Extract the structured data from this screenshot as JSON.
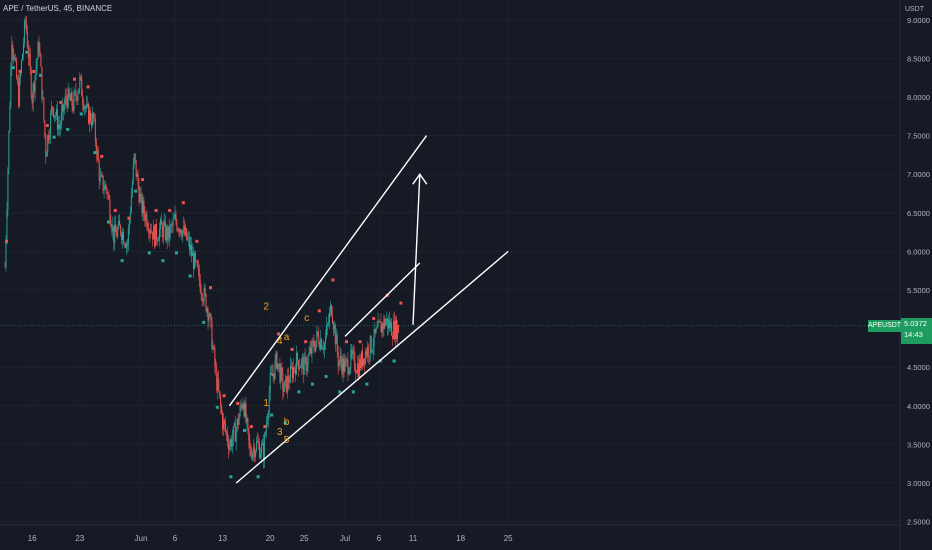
{
  "header": {
    "symbol_line": "APE / TetherUS, 45, BINANCE",
    "currency": "USDT"
  },
  "price_tag": {
    "ticker": "APEUSDT",
    "price": "5.0372",
    "countdown": "14:43"
  },
  "colors": {
    "background": "#161a25",
    "up": "#26a69a",
    "down": "#ef5350",
    "annotation": "#f7a21b",
    "line": "#ffffff"
  },
  "chart_data": {
    "type": "candlestick",
    "symbol": "APE/TetherUS",
    "interval": "45",
    "exchange": "BINANCE",
    "y_ticks": [
      "9.0000",
      "8.5000",
      "8.0000",
      "7.5000",
      "7.0000",
      "6.5000",
      "6.0000",
      "5.5000",
      "4.5000",
      "4.0000",
      "3.5000",
      "3.0000",
      "2.5000"
    ],
    "x_ticks": [
      "16",
      "23",
      "Jun",
      "6",
      "13",
      "20",
      "25",
      "Jul",
      "6",
      "11",
      "18",
      "25"
    ],
    "ylim": [
      2.45,
      9.2
    ],
    "current_price": 5.0372,
    "price_path": [
      {
        "x": "May 12",
        "y": 5.8
      },
      {
        "x": "May 13",
        "y": 8.8
      },
      {
        "x": "May 14",
        "y": 8.0
      },
      {
        "x": "May 15",
        "y": 9.0
      },
      {
        "x": "May 16",
        "y": 8.0
      },
      {
        "x": "May 17",
        "y": 8.7
      },
      {
        "x": "May 18",
        "y": 7.3
      },
      {
        "x": "May 19",
        "y": 7.9
      },
      {
        "x": "May 20",
        "y": 7.6
      },
      {
        "x": "May 21",
        "y": 8.0
      },
      {
        "x": "May 22",
        "y": 7.9
      },
      {
        "x": "May 23",
        "y": 8.2
      },
      {
        "x": "May 24",
        "y": 7.8
      },
      {
        "x": "May 25",
        "y": 7.7
      },
      {
        "x": "May 26",
        "y": 6.9
      },
      {
        "x": "May 27",
        "y": 6.8
      },
      {
        "x": "May 28",
        "y": 6.2
      },
      {
        "x": "May 29",
        "y": 6.3
      },
      {
        "x": "May 30",
        "y": 6.1
      },
      {
        "x": "May 31",
        "y": 7.2
      },
      {
        "x": "Jun 1",
        "y": 6.6
      },
      {
        "x": "Jun 2",
        "y": 6.4
      },
      {
        "x": "Jun 3",
        "y": 6.2
      },
      {
        "x": "Jun 4",
        "y": 6.3
      },
      {
        "x": "Jun 5",
        "y": 6.2
      },
      {
        "x": "Jun 6",
        "y": 6.4
      },
      {
        "x": "Jun 7",
        "y": 6.3
      },
      {
        "x": "Jun 8",
        "y": 6.1
      },
      {
        "x": "Jun 9",
        "y": 5.8
      },
      {
        "x": "Jun 10",
        "y": 5.5
      },
      {
        "x": "Jun 11",
        "y": 5.2
      },
      {
        "x": "Jun 12",
        "y": 4.4
      },
      {
        "x": "Jun 13",
        "y": 3.8
      },
      {
        "x": "Jun 14",
        "y": 3.5
      },
      {
        "x": "Jun 15",
        "y": 3.7
      },
      {
        "x": "Jun 16",
        "y": 4.1
      },
      {
        "x": "Jun 17",
        "y": 3.4
      },
      {
        "x": "Jun 18",
        "y": 3.5
      },
      {
        "x": "Jun 19",
        "y": 3.4
      },
      {
        "x": "Jun 20",
        "y": 4.3
      },
      {
        "x": "Jun 21",
        "y": 4.6
      },
      {
        "x": "Jun 22",
        "y": 4.2
      },
      {
        "x": "Jun 23",
        "y": 4.4
      },
      {
        "x": "Jun 24",
        "y": 4.6
      },
      {
        "x": "Jun 25",
        "y": 4.5
      },
      {
        "x": "Jun 26",
        "y": 4.7
      },
      {
        "x": "Jun 27",
        "y": 4.9
      },
      {
        "x": "Jun 28",
        "y": 4.8
      },
      {
        "x": "Jun 29",
        "y": 5.3
      },
      {
        "x": "Jun 30",
        "y": 4.6
      },
      {
        "x": "Jul 1",
        "y": 4.5
      },
      {
        "x": "Jul 2",
        "y": 4.6
      },
      {
        "x": "Jul 3",
        "y": 4.5
      },
      {
        "x": "Jul 4",
        "y": 4.7
      },
      {
        "x": "Jul 5",
        "y": 4.8
      },
      {
        "x": "Jul 6",
        "y": 5.0
      },
      {
        "x": "Jul 7",
        "y": 5.1
      },
      {
        "x": "Jul 8",
        "y": 5.0
      },
      {
        "x": "Jul 9",
        "y": 5.0
      }
    ],
    "annotations": [
      {
        "text": "2",
        "x": "Jun 19",
        "y": 5.25
      },
      {
        "text": "4",
        "x": "Jun 21",
        "y": 4.8
      },
      {
        "text": "a",
        "x": "Jun 22",
        "y": 4.85
      },
      {
        "text": "c",
        "x": "Jun 25",
        "y": 5.1
      },
      {
        "text": "1",
        "x": "Jun 19",
        "y": 4.0
      },
      {
        "text": "b",
        "x": "Jun 22",
        "y": 3.75
      },
      {
        "text": "3",
        "x": "Jun 21",
        "y": 3.62
      },
      {
        "text": "5",
        "x": "Jun 22",
        "y": 3.52
      }
    ],
    "trend_lines": [
      {
        "x1": "Jun 14",
        "y1": 4.0,
        "x2": "Jul 13",
        "y2": 7.5
      },
      {
        "x1": "Jun 15",
        "y1": 3.0,
        "x2": "Jul 25",
        "y2": 6.0
      },
      {
        "x1": "Jul 1",
        "y1": 4.9,
        "x2": "Jul 12",
        "y2": 5.85
      }
    ],
    "arrow": {
      "x1": "Jul 11",
      "y1": 5.05,
      "x2": "Jul 12",
      "y2": 7.0
    }
  }
}
